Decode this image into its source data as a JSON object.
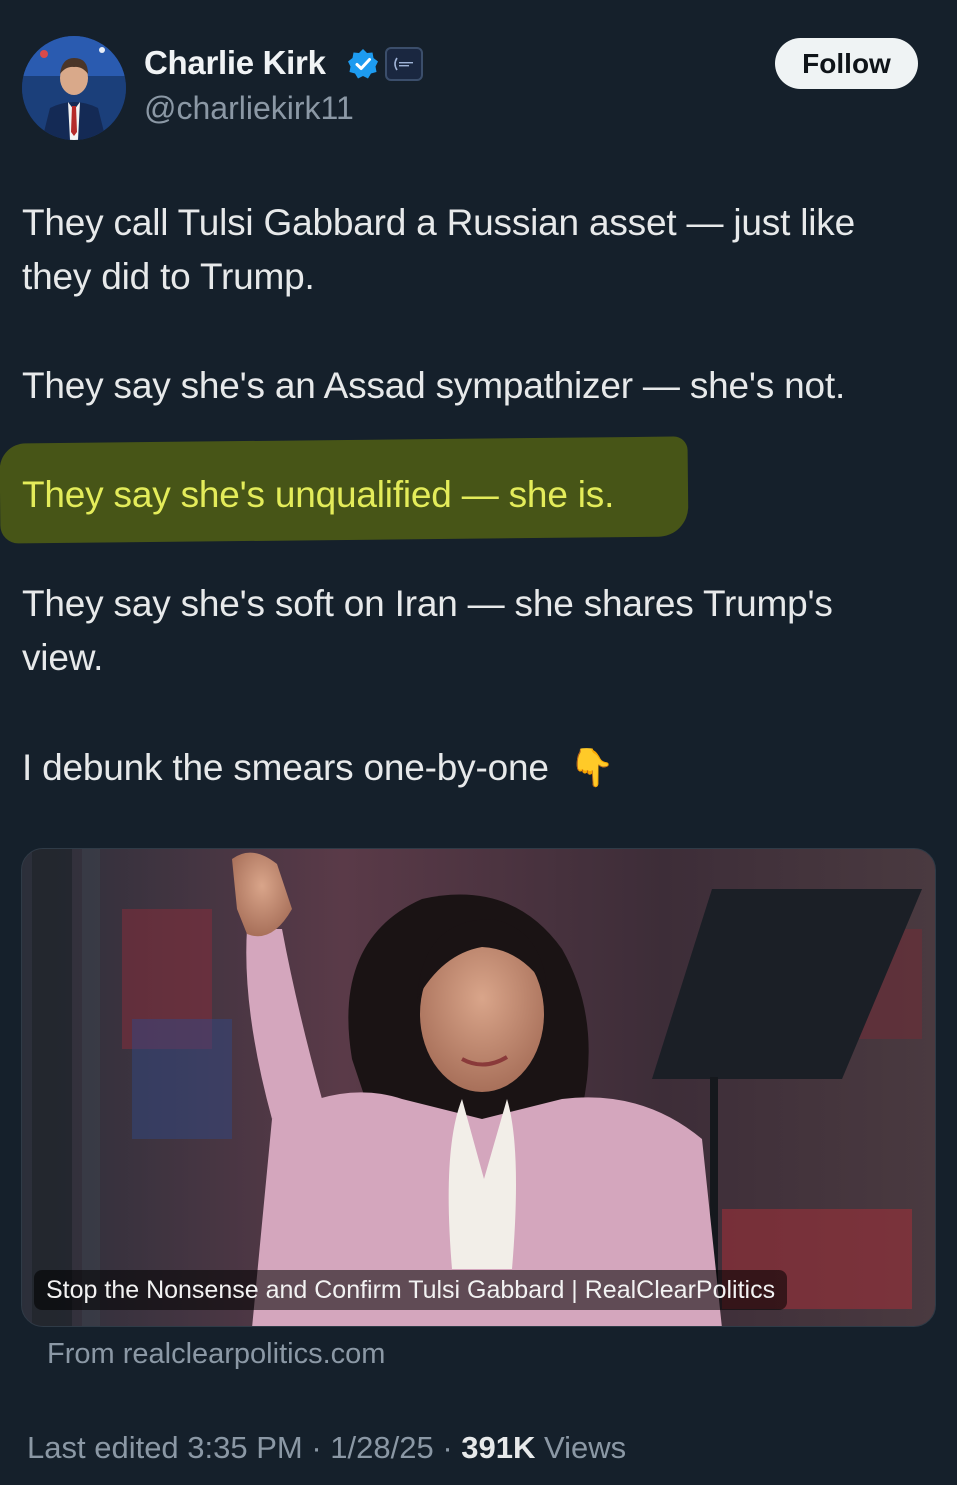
{
  "author": {
    "display_name": "Charlie Kirk",
    "handle": "@charliekirk11",
    "verified": true,
    "follow_label": "Follow"
  },
  "tweet": {
    "lines": [
      "They call Tulsi Gabbard a Russian asset — just like",
      "they did to Trump.",
      "They say she's an Assad sympathizer — she's not.",
      "They say she's unqualified — she is.",
      "They say she's soft on Iran — she shares Trump's",
      "view.",
      "I debunk the smears one-by-one"
    ],
    "emoji": "👇",
    "emoji_icon": "pointing-down-icon",
    "highlighted_line_index": 3,
    "highlight_color": "#4a5916"
  },
  "card": {
    "caption": "Stop the Nonsense and Confirm Tulsi Gabbard | RealClearPolitics",
    "source": "From realclearpolitics.com"
  },
  "meta": {
    "edited_prefix": "Last edited 3:35 PM · 1/28/25 · ",
    "views_count": "391K",
    "views_label": " Views"
  },
  "colors": {
    "background": "#15202b",
    "verified_blue": "#1d9bf0",
    "muted_text": "#8b98a5"
  }
}
